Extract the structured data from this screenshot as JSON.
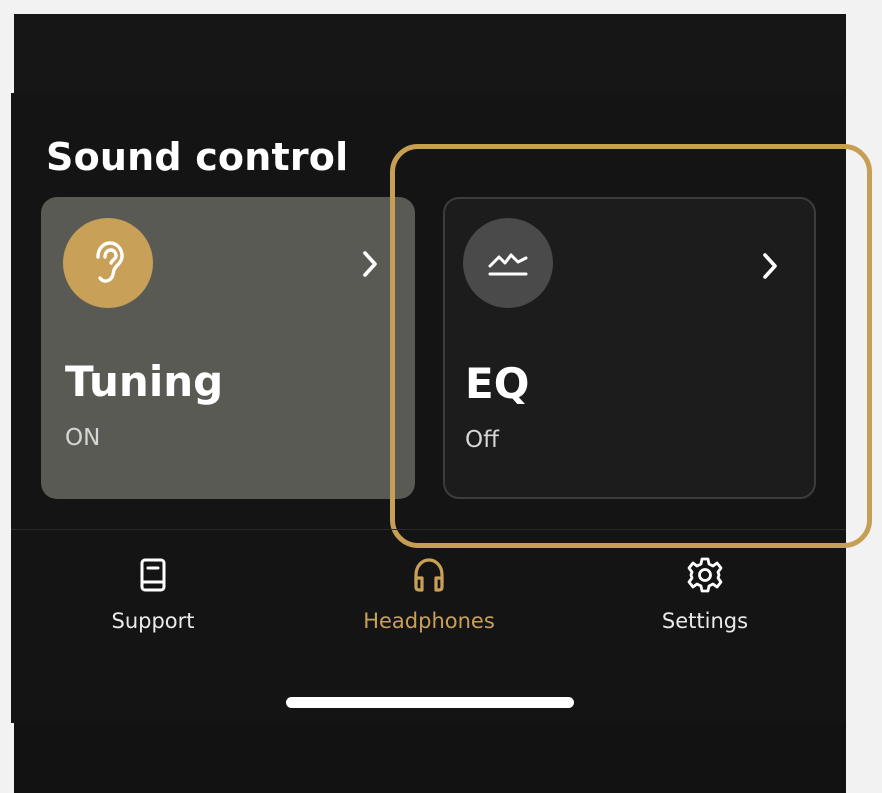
{
  "section": {
    "title": "Sound control"
  },
  "cards": [
    {
      "title": "Tuning",
      "status": "ON",
      "icon": "ear-icon",
      "icon_color": "#c8a058"
    },
    {
      "title": "EQ",
      "status": "Off",
      "icon": "eq-chart-icon",
      "icon_color": "#4a4a4a"
    }
  ],
  "nav": {
    "items": [
      {
        "label": "Support",
        "icon": "book-icon",
        "active": false
      },
      {
        "label": "Headphones",
        "icon": "headphones-icon",
        "active": true
      },
      {
        "label": "Settings",
        "icon": "gear-icon",
        "active": false
      }
    ]
  },
  "colors": {
    "accent": "#c8a058",
    "highlight": "#c79f54",
    "background": "#141414",
    "card_active": "#5a5a55",
    "card_inactive": "#1c1c1c"
  }
}
